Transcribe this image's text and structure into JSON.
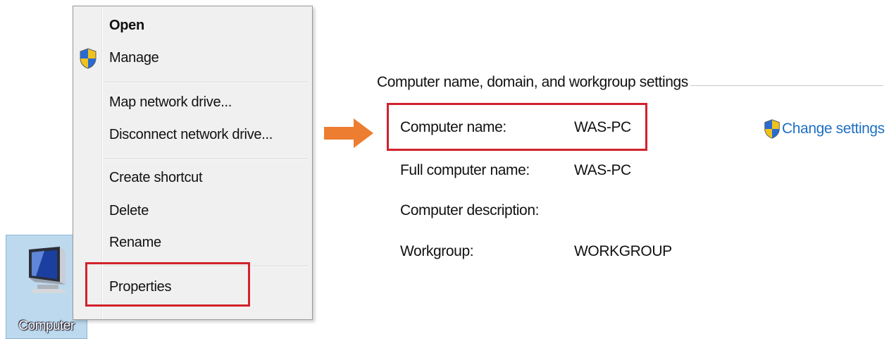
{
  "desktop_icon": {
    "label": "Computer",
    "icon": "computer-monitor-icon"
  },
  "context_menu": {
    "items": [
      {
        "label": "Open",
        "bold": true
      },
      {
        "label": "Manage",
        "icon": "uac-shield-icon"
      },
      {
        "label": "Map network drive..."
      },
      {
        "label": "Disconnect network drive..."
      },
      {
        "label": "Create shortcut"
      },
      {
        "label": "Delete"
      },
      {
        "label": "Rename"
      },
      {
        "label": "Properties",
        "highlighted": true
      }
    ]
  },
  "arrow": {
    "icon": "right-arrow-icon",
    "color": "#ed7d31"
  },
  "system_settings": {
    "group_title": "Computer name, domain, and workgroup settings",
    "rows": [
      {
        "label": "Computer name:",
        "value": "WAS-PC",
        "highlighted": true
      },
      {
        "label": "Full computer name:",
        "value": "WAS-PC"
      },
      {
        "label": "Computer description:",
        "value": ""
      },
      {
        "label": "Workgroup:",
        "value": "WORKGROUP"
      }
    ],
    "change_link": {
      "label": "Change settings",
      "icon": "uac-shield-icon"
    }
  },
  "colors": {
    "highlight_box": "#d1222c",
    "link": "#1e6fc4"
  }
}
